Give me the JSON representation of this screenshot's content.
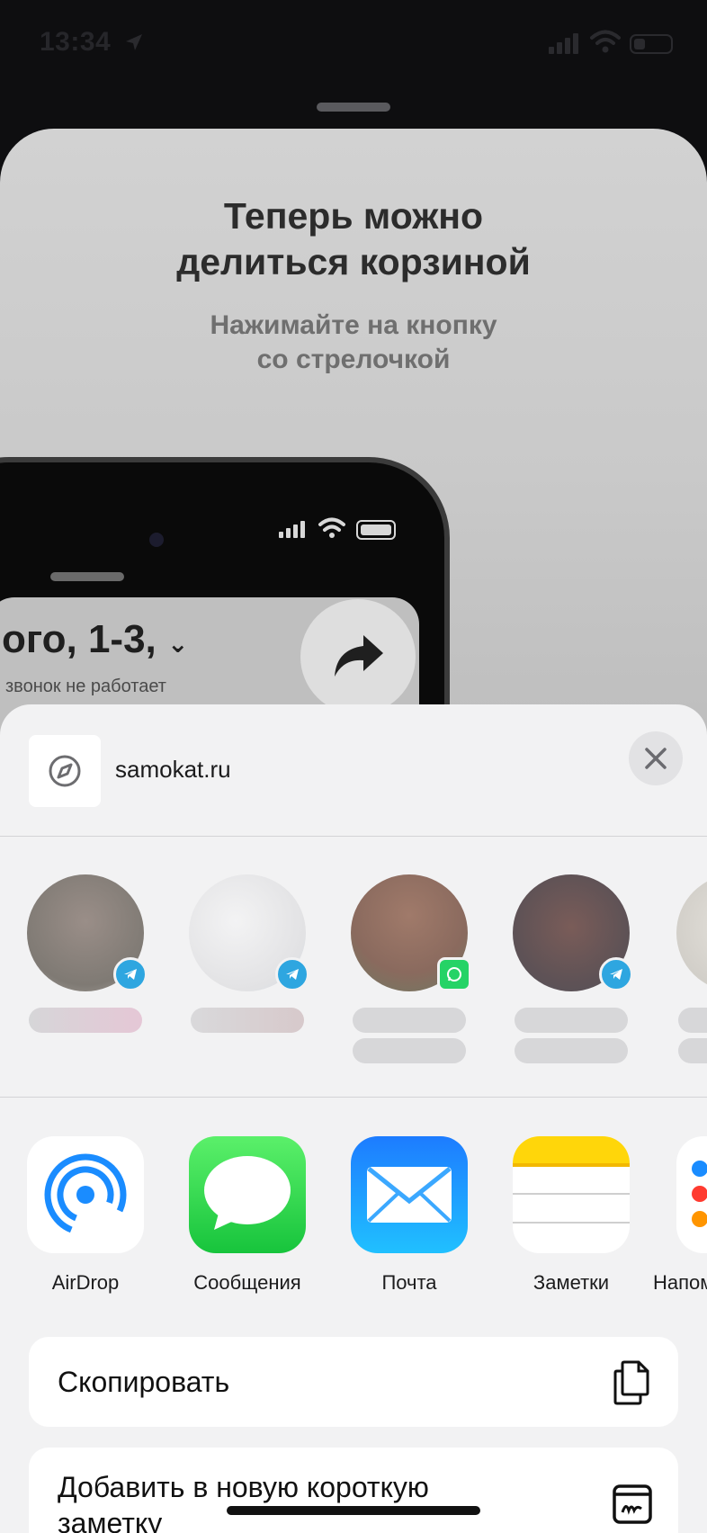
{
  "status_bar": {
    "time": "13:34"
  },
  "promo": {
    "title_line1": "Теперь можно",
    "title_line2": "делиться корзиной",
    "subtitle_line1": "Нажимайте на кнопку",
    "subtitle_line2": "со стрелочкой",
    "phone_address": "ого, 1-3,",
    "phone_note": "звонок не работает"
  },
  "share_sheet": {
    "site": "samokat.ru",
    "contacts": [
      {
        "app_badge": "telegram-icon",
        "avatar_color": "#8f8a86"
      },
      {
        "app_badge": "telegram-icon",
        "avatar_color": "#e6e6e8"
      },
      {
        "app_badge": "whatsapp-icon",
        "avatar_color": "#8a6a5e"
      },
      {
        "app_badge": "telegram-icon",
        "avatar_color": "#6a5a5c"
      },
      {
        "app_badge": "telegram-icon",
        "avatar_color": "#d9d7d2"
      }
    ],
    "apps": [
      {
        "label": "AirDrop",
        "icon": "airdrop-icon"
      },
      {
        "label": "Сообщения",
        "icon": "messages-icon"
      },
      {
        "label": "Почта",
        "icon": "mail-icon"
      },
      {
        "label": "Заметки",
        "icon": "notes-icon"
      },
      {
        "label": "Напоминания",
        "icon": "reminders-icon"
      }
    ],
    "actions": [
      {
        "label": "Скопировать",
        "icon": "copy-icon"
      },
      {
        "label_line1": "Добавить в новую короткую",
        "label_line2": "заметку",
        "icon": "quick-note-icon"
      }
    ]
  },
  "colors": {
    "telegram": "#2ea6e0",
    "whatsapp": "#25d366",
    "airdrop": "#1a8cff",
    "messages": "#2fd24a",
    "mail": "#1aa0ff",
    "notes": "#ffd60a"
  }
}
